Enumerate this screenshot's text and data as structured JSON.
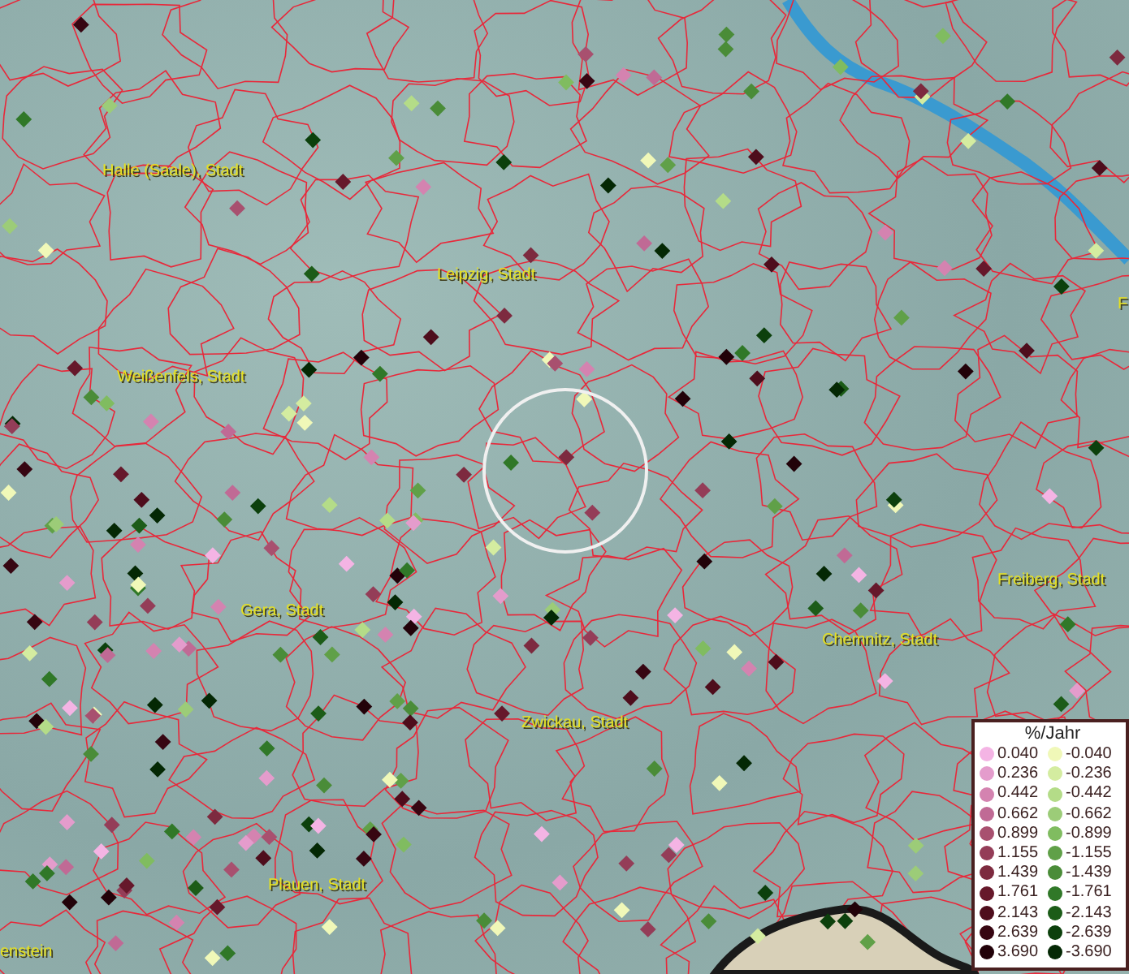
{
  "places": [
    {
      "name": "Halle (Saale), Stadt"
    },
    {
      "name": "Leipzig, Stadt"
    },
    {
      "name": "Weißenfels, Stadt"
    },
    {
      "name": "Gera, Stadt"
    },
    {
      "name": "Chemnitz, Stadt"
    },
    {
      "name": "Freiberg, Stadt"
    },
    {
      "name": "Zwickau, Stadt"
    },
    {
      "name": "Plauen, Stadt"
    },
    {
      "name": "enstein"
    },
    {
      "name": "F"
    }
  ],
  "legend": {
    "title": "%/Jahr",
    "positive": [
      {
        "label": "0.040",
        "color": "#f4b4e4"
      },
      {
        "label": "0.236",
        "color": "#e49ccc"
      },
      {
        "label": "0.442",
        "color": "#d483b0"
      },
      {
        "label": "0.662",
        "color": "#c06a95"
      },
      {
        "label": "0.899",
        "color": "#a8506f"
      },
      {
        "label": "1.155",
        "color": "#943d58"
      },
      {
        "label": "1.439",
        "color": "#7d2a3f"
      },
      {
        "label": "1.761",
        "color": "#66182b"
      },
      {
        "label": "2.143",
        "color": "#4e0d1c"
      },
      {
        "label": "2.639",
        "color": "#370612"
      },
      {
        "label": "3.690",
        "color": "#220209"
      }
    ],
    "negative": [
      {
        "label": "-0.040",
        "color": "#f0f8b8"
      },
      {
        "label": "-0.236",
        "color": "#d4eca0"
      },
      {
        "label": "-0.442",
        "color": "#b4dc88"
      },
      {
        "label": "-0.662",
        "color": "#9ccc78"
      },
      {
        "label": "-0.899",
        "color": "#80bc60"
      },
      {
        "label": "-1.155",
        "color": "#60a048"
      },
      {
        "label": "-1.439",
        "color": "#4a8c38"
      },
      {
        "label": "-1.761",
        "color": "#307828"
      },
      {
        "label": "-2.143",
        "color": "#1c5c18"
      },
      {
        "label": "-2.639",
        "color": "#0c400c"
      },
      {
        "label": "-3.690",
        "color": "#042804"
      }
    ]
  }
}
